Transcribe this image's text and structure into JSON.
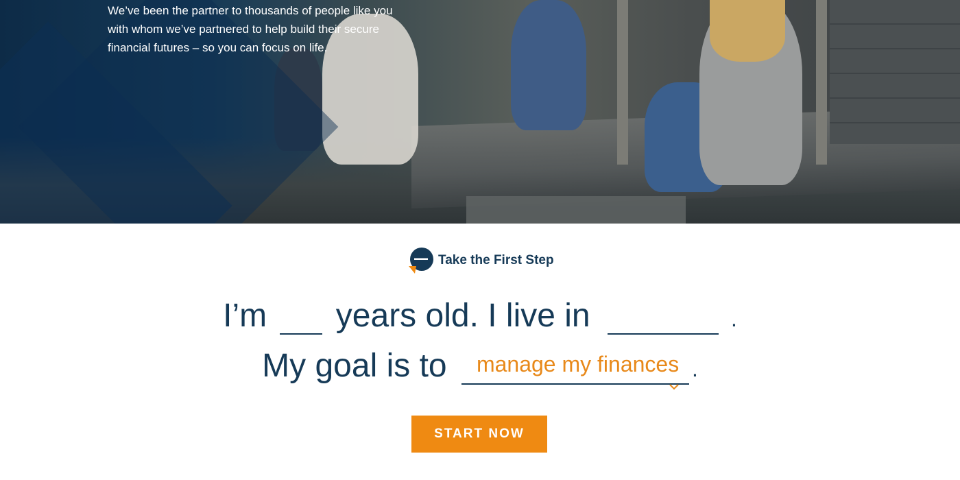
{
  "hero": {
    "text": "We’ve been the partner to thousands of people like you with whom we’ve partnered to help build their secure financial futures – so you can focus on life."
  },
  "brand": {
    "label": "Take the First Step",
    "icon": "speech-bubble-logo-icon"
  },
  "form": {
    "line1_prefix": "I’m",
    "line1_middle": "years old. I live in",
    "line1_suffix": ".",
    "age_value": "",
    "location_value": "",
    "line2_prefix": "My goal is to",
    "goal_selected": "manage my finances",
    "line2_suffix": ".",
    "submit_label": "START NOW"
  },
  "colors": {
    "navy": "#163a57",
    "orange": "#ef8a12",
    "goal_text": "#e8891a"
  }
}
